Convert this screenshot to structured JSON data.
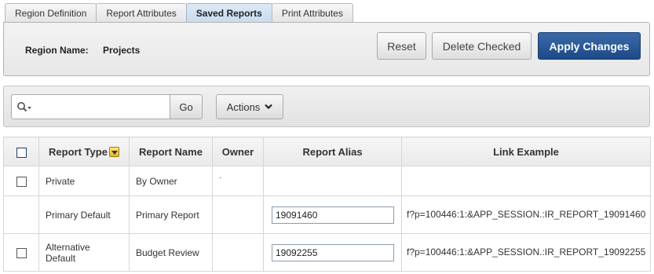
{
  "tabs": [
    {
      "label": "Region Definition"
    },
    {
      "label": "Report Attributes"
    },
    {
      "label": "Saved Reports"
    },
    {
      "label": "Print Attributes"
    }
  ],
  "region": {
    "name_label": "Region Name:",
    "name_value": "Projects"
  },
  "buttons": {
    "reset": "Reset",
    "delete_checked": "Delete Checked",
    "apply_changes": "Apply Changes"
  },
  "search": {
    "value": "",
    "go_label": "Go",
    "actions_label": "Actions"
  },
  "table": {
    "headers": {
      "report_type": "Report Type",
      "report_name": "Report Name",
      "owner": "Owner",
      "report_alias": "Report Alias",
      "link_example": "Link Example"
    },
    "rows": [
      {
        "report_type": "Private",
        "report_name": "By Owner",
        "owner": "·",
        "report_alias": "",
        "link_example": ""
      },
      {
        "report_type": "Primary Default",
        "report_name": "Primary Report",
        "owner": "",
        "report_alias": "19091460",
        "link_example": "f?p=100446:1:&APP_SESSION.:IR_REPORT_19091460"
      },
      {
        "report_type": "Alternative Default",
        "report_name": "Budget Review",
        "owner": "",
        "report_alias": "19092255",
        "link_example": "f?p=100446:1:&APP_SESSION.:IR_REPORT_19092255"
      }
    ]
  },
  "colors": {
    "apply_button": "#2a5a9a",
    "active_tab": "#d3e2f3",
    "sort_icon": "#f2c94c"
  }
}
